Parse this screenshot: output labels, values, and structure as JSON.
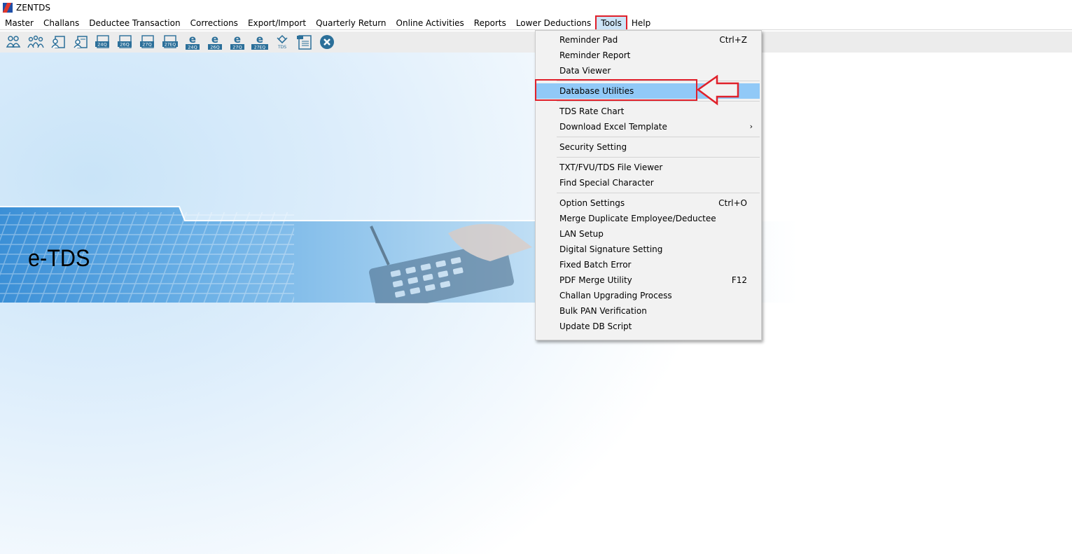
{
  "window": {
    "title": "ZENTDS"
  },
  "menubar": {
    "items": [
      "Master",
      "Challans",
      "Deductee Transaction",
      "Corrections",
      "Export/Import",
      "Quarterly Return",
      "Online Activities",
      "Reports",
      "Lower Deductions",
      "Tools",
      "Help"
    ],
    "active": "Tools"
  },
  "toolbar": {
    "buttons": [
      {
        "icon": "users-icon",
        "label": ""
      },
      {
        "icon": "group-icon",
        "label": ""
      },
      {
        "icon": "person-form-icon",
        "label": ""
      },
      {
        "icon": "person-form-alt-icon",
        "label": ""
      },
      {
        "icon": "form-24q-icon",
        "label": "24Q"
      },
      {
        "icon": "form-26q-icon",
        "label": "26Q"
      },
      {
        "icon": "form-27q-icon",
        "label": "27Q"
      },
      {
        "icon": "form-27eq-icon",
        "label": "27EQ"
      },
      {
        "icon": "efile-24q-icon",
        "label": "24Q"
      },
      {
        "icon": "efile-26q-icon",
        "label": "26Q"
      },
      {
        "icon": "efile-27q-icon",
        "label": "27Q"
      },
      {
        "icon": "efile-27eq-icon",
        "label": "27EQ"
      },
      {
        "icon": "tds-logo-icon",
        "label": "TDS"
      },
      {
        "icon": "document-icon",
        "label": ""
      },
      {
        "icon": "close-circle-icon",
        "label": ""
      }
    ]
  },
  "banner": {
    "text": "e-TDS"
  },
  "dropdown": {
    "items": [
      {
        "label": "Reminder Pad",
        "shortcut": "Ctrl+Z"
      },
      {
        "label": "Reminder Report",
        "shortcut": ""
      },
      {
        "label": "Data Viewer",
        "shortcut": ""
      },
      {
        "label": "Database Utilities",
        "shortcut": "",
        "highlighted": true
      },
      {
        "label": "TDS Rate Chart",
        "shortcut": ""
      },
      {
        "label": "Download Excel Template",
        "shortcut": "",
        "submenu": true
      },
      {
        "label": "Security Setting",
        "shortcut": ""
      },
      {
        "label": "TXT/FVU/TDS File Viewer",
        "shortcut": ""
      },
      {
        "label": "Find Special Character",
        "shortcut": ""
      },
      {
        "label": "Option Settings",
        "shortcut": "Ctrl+O"
      },
      {
        "label": "Merge Duplicate Employee/Deductee",
        "shortcut": ""
      },
      {
        "label": "LAN Setup",
        "shortcut": ""
      },
      {
        "label": "Digital Signature Setting",
        "shortcut": ""
      },
      {
        "label": "Fixed Batch Error",
        "shortcut": ""
      },
      {
        "label": "PDF Merge Utility",
        "shortcut": "F12"
      },
      {
        "label": "Challan Upgrading Process",
        "shortcut": ""
      },
      {
        "label": "Bulk PAN Verification",
        "shortcut": ""
      },
      {
        "label": "Update DB Script",
        "shortcut": ""
      }
    ],
    "submenu_arrow": "›"
  },
  "colors": {
    "highlight": "#91c9f7",
    "annotation_red": "#e0202a",
    "toolbar_icon": "#2b6f99"
  }
}
